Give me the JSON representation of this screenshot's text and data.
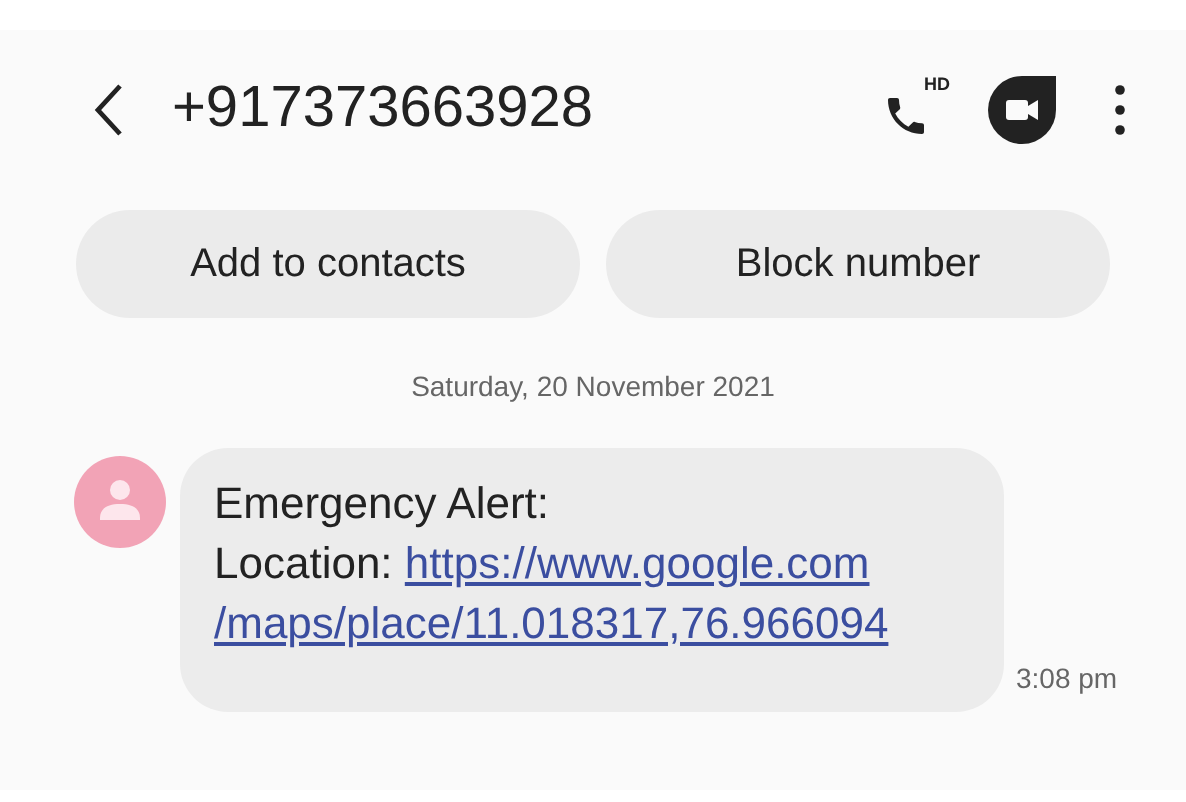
{
  "header": {
    "title": "+917373663928",
    "call_badge": "HD"
  },
  "actions": [
    "Add to contacts",
    "Block number"
  ],
  "date": "Saturday, 20 November 2021",
  "message": {
    "heading": "Emergency Alert:",
    "label": "Location: ",
    "link_lines": [
      "https://www.google.com",
      "/maps/place/11.018317,76.966094"
    ],
    "time": "3:08 pm"
  }
}
